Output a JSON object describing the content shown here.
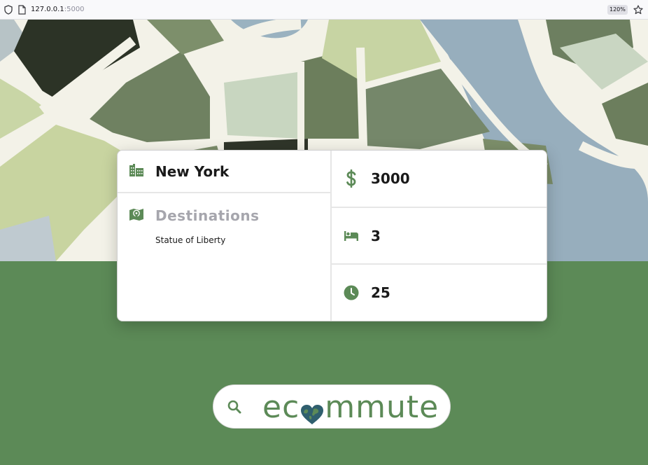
{
  "browser": {
    "url_host": "127.0.0.1",
    "url_port": ":5000",
    "zoom": "120%"
  },
  "trip": {
    "city": "New York",
    "destinations_title": "Destinations",
    "destinations": [
      "Statue of Liberty"
    ],
    "budget": "3000",
    "beds": "3",
    "time": "25"
  },
  "brand": {
    "logo_prefix": "ec",
    "logo_suffix": "mmute"
  },
  "colors": {
    "accent": "#5c8a57",
    "muted_heading": "#a6a6ad"
  },
  "icons": {
    "city": "city-icon",
    "destinations": "map-marker-icon",
    "budget": "dollar-icon",
    "beds": "bed-icon",
    "time": "clock-icon",
    "search": "search-icon"
  }
}
